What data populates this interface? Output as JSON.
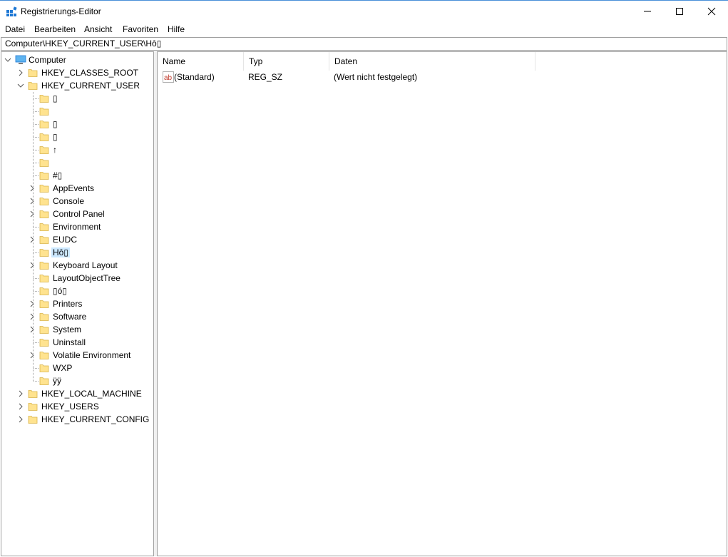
{
  "window": {
    "title": "Registrierungs-Editor",
    "controls": {
      "minimize": "minimize",
      "maximize": "maximize",
      "close": "close"
    }
  },
  "menu": {
    "items": [
      {
        "label": "Datei"
      },
      {
        "label": "Bearbeiten"
      },
      {
        "label": "Ansicht"
      },
      {
        "label": "Favoriten"
      },
      {
        "label": "Hilfe"
      }
    ]
  },
  "address": {
    "path": "Computer\\HKEY_CURRENT_USER\\Hô▯"
  },
  "tree": {
    "root": {
      "label": "Computer",
      "expanded": true
    },
    "hives": [
      {
        "label": "HKEY_CLASSES_ROOT",
        "expanded": false
      },
      {
        "label": "HKEY_CURRENT_USER",
        "expanded": true
      },
      {
        "label": "HKEY_LOCAL_MACHINE",
        "expanded": false
      },
      {
        "label": "HKEY_USERS",
        "expanded": false
      },
      {
        "label": "HKEY_CURRENT_CONFIG",
        "expanded": false
      }
    ],
    "hkcu_children": [
      {
        "label": "▯",
        "has_children": false
      },
      {
        "label": "",
        "has_children": false
      },
      {
        "label": "▯",
        "has_children": false
      },
      {
        "label": "▯",
        "has_children": false
      },
      {
        "label": "↑",
        "has_children": false
      },
      {
        "label": "",
        "has_children": false
      },
      {
        "label": "#▯",
        "has_children": false
      },
      {
        "label": "AppEvents",
        "has_children": true
      },
      {
        "label": "Console",
        "has_children": true
      },
      {
        "label": "Control Panel",
        "has_children": true
      },
      {
        "label": "Environment",
        "has_children": false
      },
      {
        "label": "EUDC",
        "has_children": true
      },
      {
        "label": "Hô▯",
        "has_children": false,
        "selected": true
      },
      {
        "label": "Keyboard Layout",
        "has_children": true
      },
      {
        "label": "LayoutObjectTree",
        "has_children": false
      },
      {
        "label": "▯ó▯",
        "has_children": false
      },
      {
        "label": "Printers",
        "has_children": true
      },
      {
        "label": "Software",
        "has_children": true
      },
      {
        "label": "System",
        "has_children": true
      },
      {
        "label": "Uninstall",
        "has_children": false
      },
      {
        "label": "Volatile Environment",
        "has_children": true
      },
      {
        "label": "WXP",
        "has_children": false
      },
      {
        "label": "ÿÿ",
        "has_children": false
      }
    ]
  },
  "list": {
    "columns": [
      {
        "label": "Name"
      },
      {
        "label": "Typ"
      },
      {
        "label": "Daten"
      }
    ],
    "rows": [
      {
        "icon": "string-value-icon",
        "name": "(Standard)",
        "type": "REG_SZ",
        "data": "(Wert nicht festgelegt)"
      }
    ]
  },
  "colors": {
    "selection": "#cce8ff",
    "border": "#a0a0a0",
    "folder": "#ffe38f",
    "accent": "#1e78d4"
  }
}
